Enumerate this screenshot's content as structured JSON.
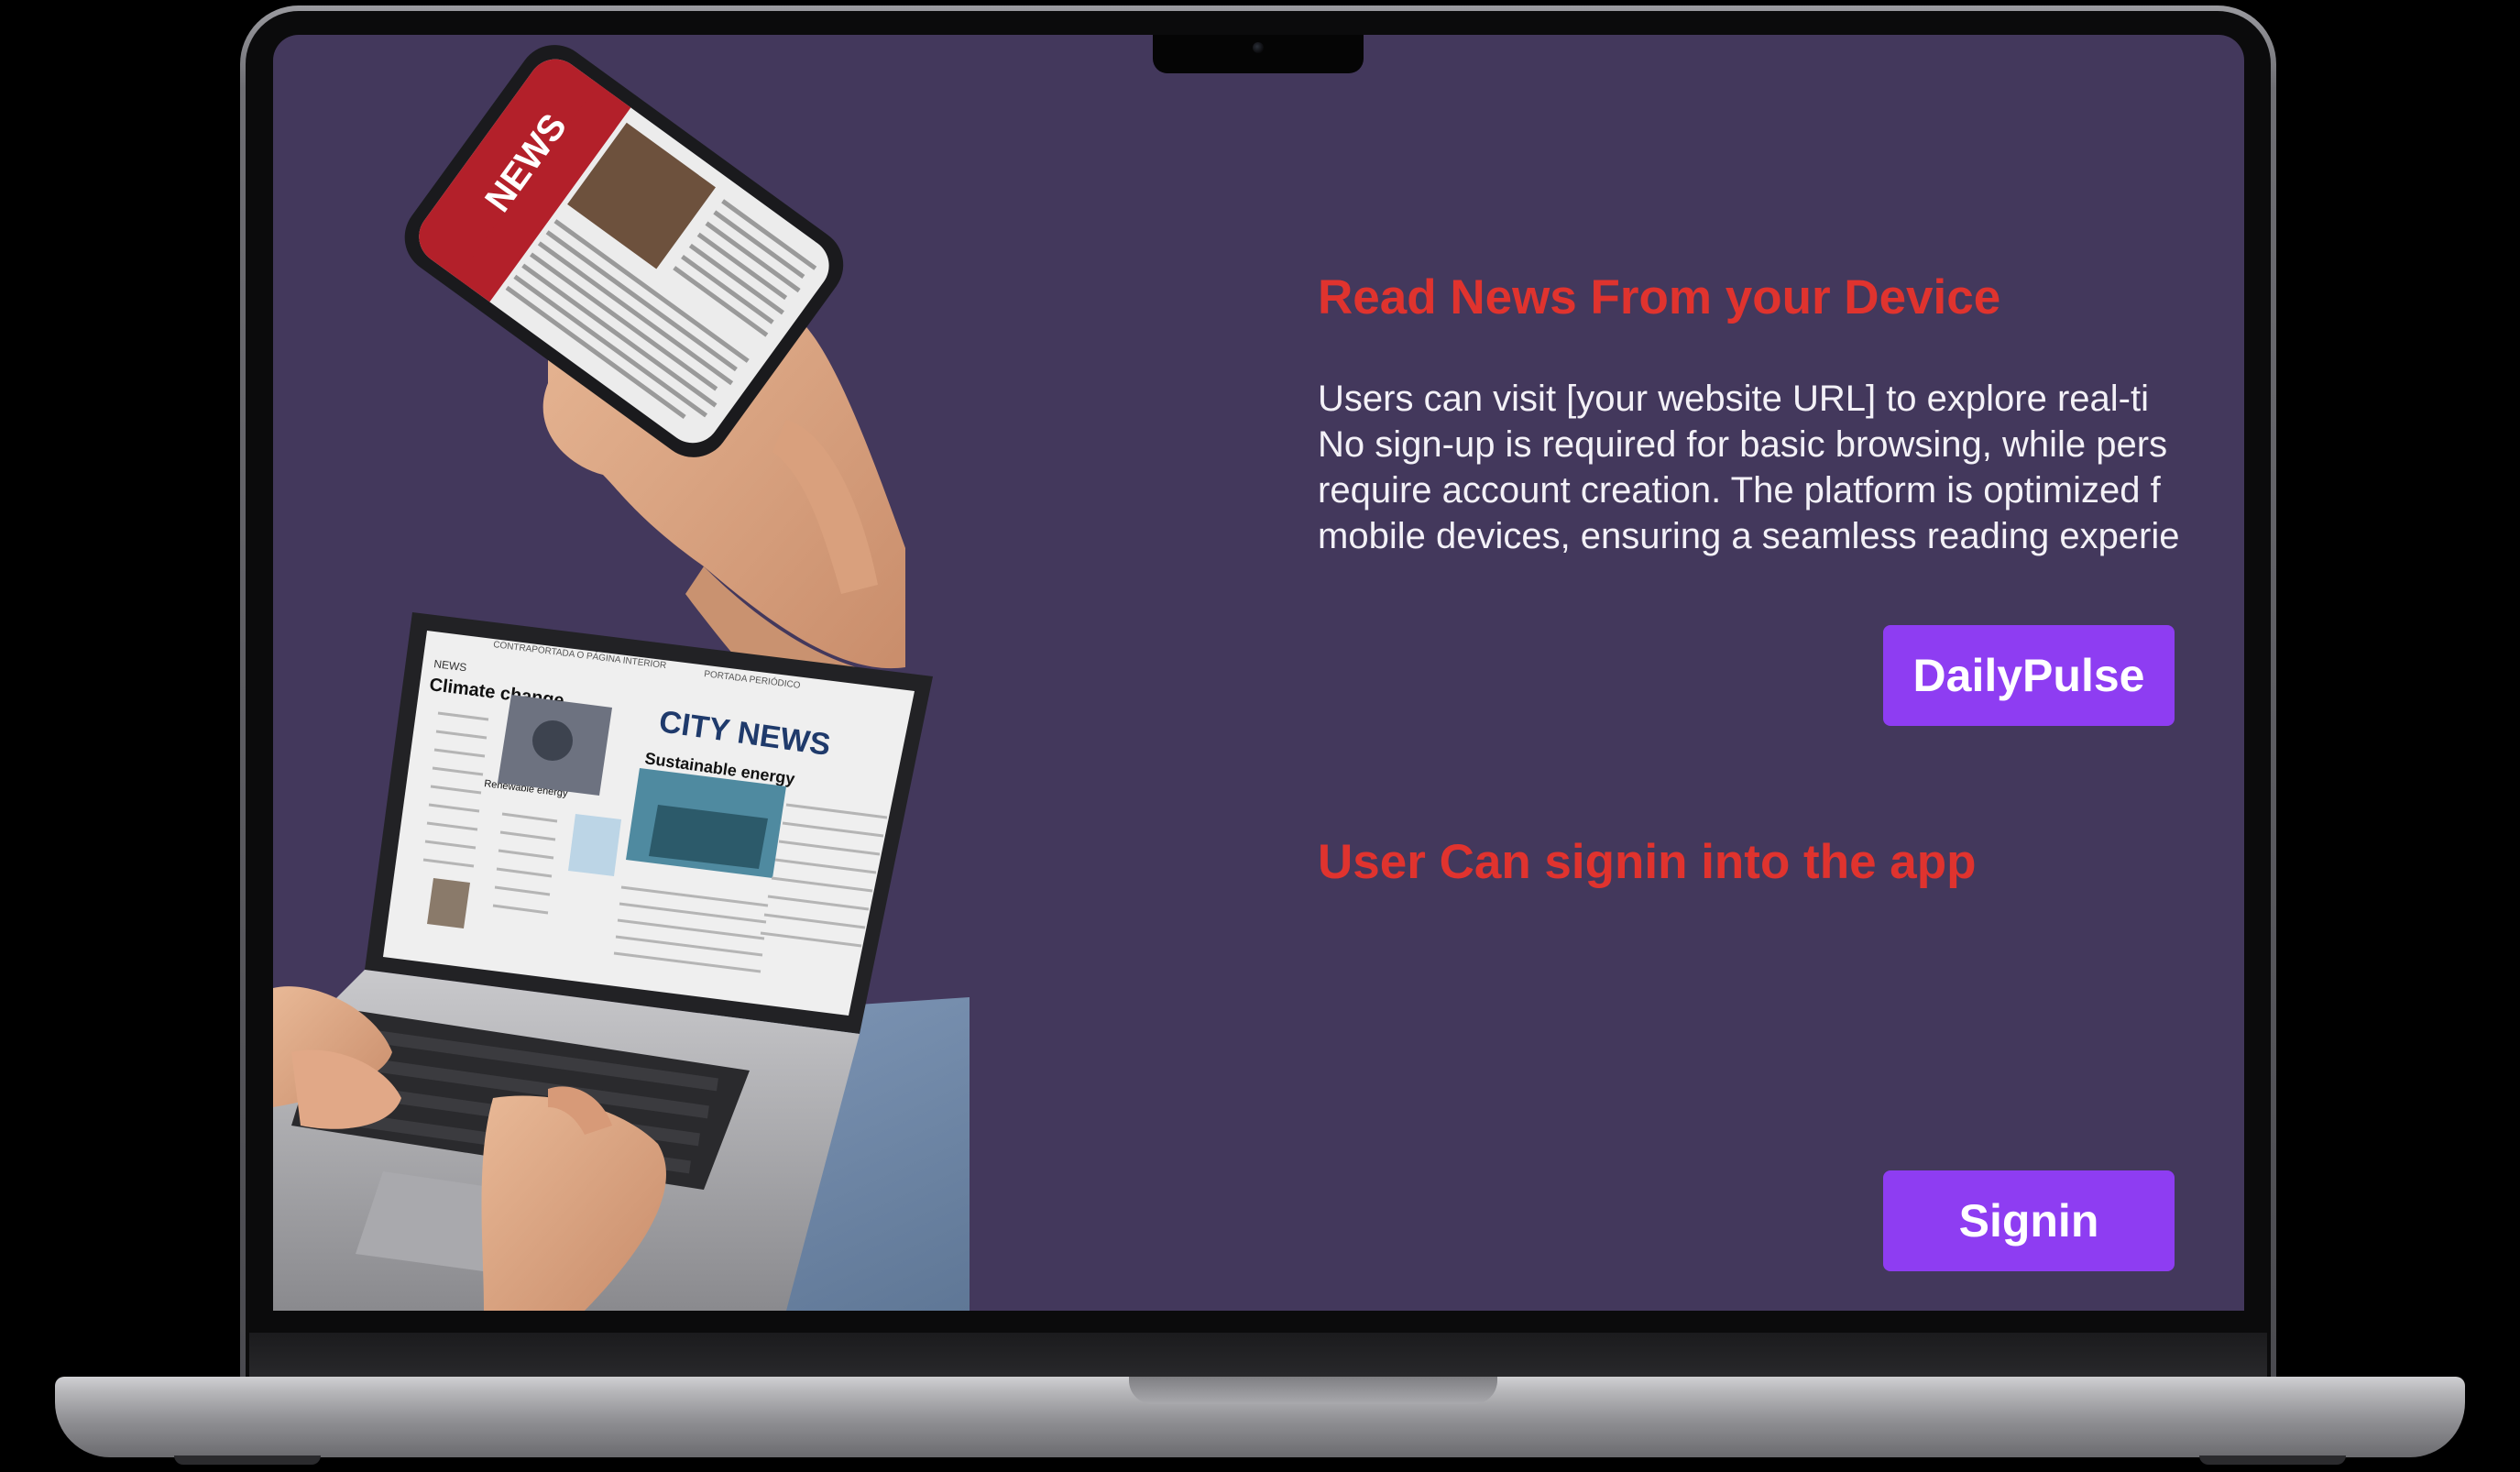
{
  "section_1": {
    "heading": "Read News From your Device",
    "paragraph": "Users can visit [your website URL] to explore real-ti\nNo sign-up is required for basic browsing, while pers\nrequire account creation. The platform is optimized f\nmobile devices, ensuring a seamless reading experie",
    "button_label": "DailyPulse"
  },
  "section_2": {
    "heading": "User Can signin into the app",
    "button_label": "Signin"
  },
  "illustration": {
    "phone_screen_text": "NEWS",
    "laptop_news": {
      "masthead_top": "CONTRAPORTADA O PÁGINA INTERIOR",
      "masthead_right": "PORTADA PERIÓDICO",
      "section_label": "NEWS",
      "headline_left": "Climate change",
      "subhead_left": "Renewable energy",
      "title": "CITY NEWS",
      "subtitle": "Sustainable energy"
    }
  },
  "colors": {
    "screen_background": "#43385c",
    "heading": "#e0332e",
    "button": "#8e3df2",
    "body_text": "#f3f1f7"
  }
}
